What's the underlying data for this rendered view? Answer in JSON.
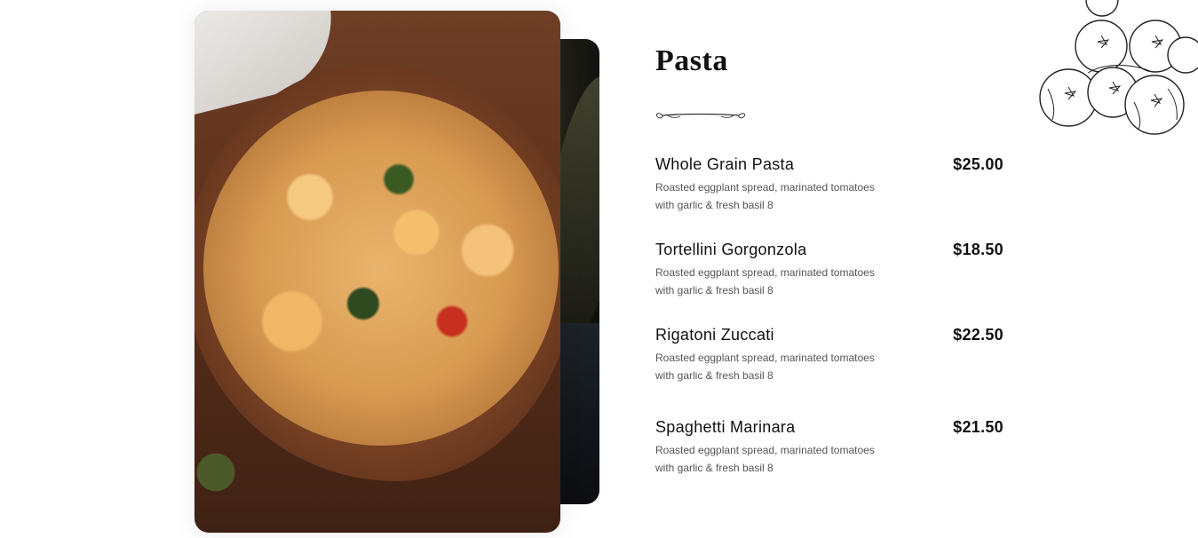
{
  "menu": {
    "title": "Pasta",
    "items": [
      {
        "name": "Whole Grain Pasta",
        "price": "$25.00",
        "description": "Roasted eggplant spread, marinated tomatoes with garlic & fresh basil 8"
      },
      {
        "name": "Tortellini Gorgonzola",
        "price": "$18.50",
        "description": "Roasted eggplant spread, marinated tomatoes with garlic & fresh basil 8"
      },
      {
        "name": "Rigatoni Zuccati",
        "price": "$22.50",
        "description": "Roasted eggplant spread, marinated tomatoes with garlic & fresh basil 8"
      },
      {
        "name": "Spaghetti Marinara",
        "price": "$21.50",
        "description": "Roasted eggplant spread, marinated tomatoes with garlic & fresh basil 8"
      }
    ]
  },
  "icons": {
    "divider": "ornamental-divider-icon",
    "decoration": "tomato-sketch-icon"
  },
  "colors": {
    "text": "#111111",
    "description": "#555555",
    "background": "#ffffff"
  }
}
